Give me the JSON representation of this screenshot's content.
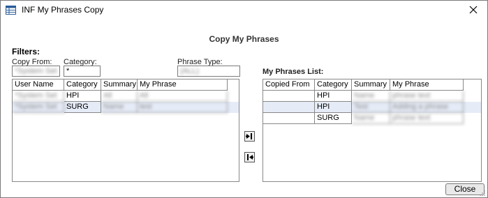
{
  "window": {
    "title": "INF My Phrases Copy",
    "icon": "table-window-icon"
  },
  "header": {
    "title": "Copy My Phrases"
  },
  "filters": {
    "title": "Filters:",
    "copy_from_label": "Copy From:",
    "copy_from_value": "*System Set",
    "category_label": "Category:",
    "category_value": "*",
    "phrase_type_label": "Phrase Type:",
    "phrase_type_value": "(ALL)"
  },
  "source_grid": {
    "columns": [
      "User Name",
      "Category",
      "Summary",
      "My Phrase"
    ],
    "rows": [
      [
        "*System Set",
        "HPI",
        "All",
        "All"
      ],
      [
        "*System Set",
        "SURG",
        "Name",
        "test"
      ]
    ]
  },
  "my_phrases": {
    "title": "My Phrases List:",
    "columns": [
      "Copied From",
      "Category",
      "Summary",
      "My Phrase"
    ],
    "rows": [
      [
        "",
        "HPI",
        "Name",
        "phrase text"
      ],
      [
        "",
        "HPI",
        "Test",
        "Adding a phrase"
      ],
      [
        "",
        "SURG",
        "Name",
        "phrase text"
      ]
    ]
  },
  "buttons": {
    "add_icon": "move-right-icon",
    "remove_icon": "move-left-icon",
    "close_label": "Close"
  }
}
